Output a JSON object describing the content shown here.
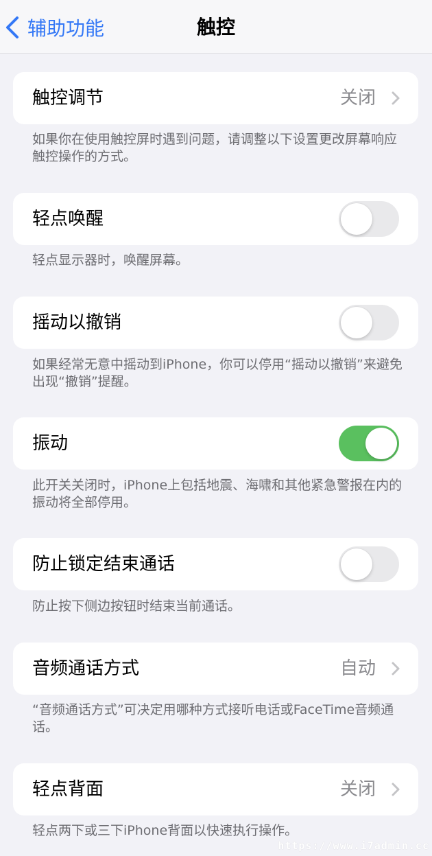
{
  "nav": {
    "back_label": "辅助功能",
    "title": "触控"
  },
  "rows": [
    {
      "label": "触控调节",
      "value": "关闭",
      "footer": "如果你在使用触控屏时遇到问题，请调整以下设置更改屏幕响应触控操作的方式。"
    },
    {
      "label": "轻点唤醒",
      "toggle": false,
      "footer": "轻点显示器时，唤醒屏幕。"
    },
    {
      "label": "摇动以撤销",
      "toggle": false,
      "footer": "如果经常无意中摇动到iPhone，你可以停用“摇动以撤销”来避免出现“撤销”提醒。"
    },
    {
      "label": "振动",
      "toggle": true,
      "footer": "此开关关闭时，iPhone上包括地震、海啸和其他紧急警报在内的振动将全部停用。"
    },
    {
      "label": "防止锁定结束通话",
      "toggle": false,
      "footer": "防止按下侧边按钮时结束当前通话。"
    },
    {
      "label": "音频通话方式",
      "value": "自动",
      "footer": "“音频通话方式”可决定用哪种方式接听电话或FaceTime音频通话。"
    },
    {
      "label": "轻点背面",
      "value": "关闭",
      "footer": "轻点两下或三下iPhone背面以快速执行操作。"
    }
  ],
  "watermark": "https://www.i7admin.cc",
  "colors": {
    "accent": "#3478f6",
    "toggle_on": "#5ac05f",
    "toggle_off": "#e9e9eb",
    "background": "#f2f2f7"
  }
}
